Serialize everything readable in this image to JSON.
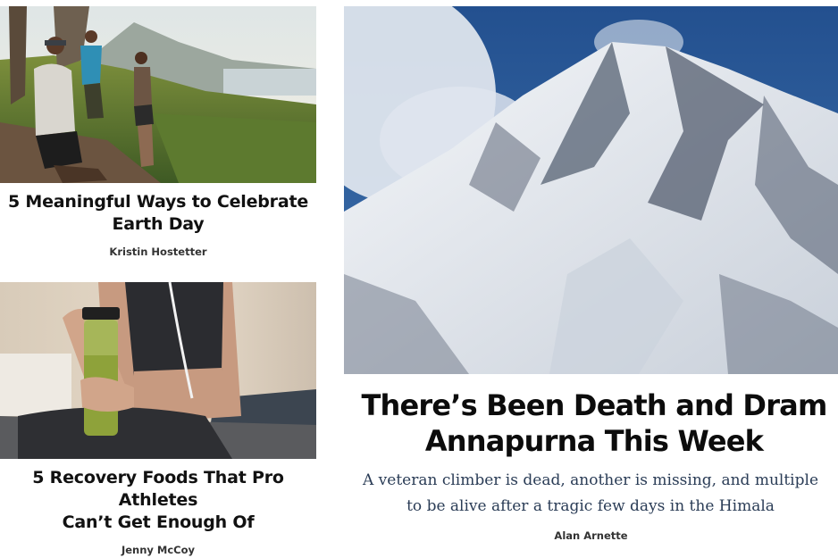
{
  "articles": [
    {
      "title_line1": "5 Meaningful Ways to Celebrate",
      "title_line2": "Earth Day",
      "author": "Kristin Hostetter",
      "image": "hikers-on-coastal-mountain-trail"
    },
    {
      "title_line1": "5 Recovery Foods That Pro Athletes",
      "title_line2": "Can’t Get Enough Of",
      "author": "Jenny McCoy",
      "image": "athlete-holding-green-smoothie"
    }
  ],
  "feature": {
    "title_line1": "There’s Been Death and Dram",
    "title_line2": "Annapurna This Week",
    "dek_line1": "A veteran climber is dead, another is missing, and multiple",
    "dek_line2": "to be alive after a tragic few days in the Himala",
    "author": "Alan Arnette",
    "image": "snow-covered-annapurna-peak"
  }
}
